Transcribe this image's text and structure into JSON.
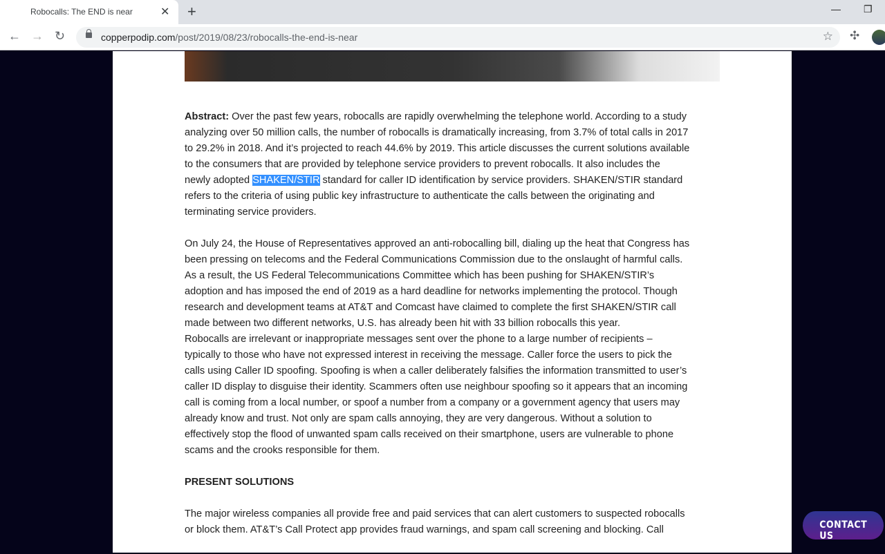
{
  "browser": {
    "tab_title": "Robocalls: The END is near",
    "url_domain": "copperpodip.com",
    "url_path": "/post/2019/08/23/robocalls-the-end-is-near"
  },
  "article": {
    "abstract_label": "Abstract:",
    "abstract_lines": [
      " Over the past few years, robocalls are rapidly overwhelming the telephone world. According to a study",
      "analyzing over 50 million calls, the number of robocalls is dramatically increasing, from 3.7% of total calls in 2017",
      "to 29.2% in 2018. And it’s projected to reach 44.6% by 2019. This article discusses the current solutions available",
      "to the consumers that are provided by telephone service providers to prevent robocalls. It also includes the"
    ],
    "abstract_pre_highlight": "newly adopted ",
    "abstract_highlight": "SHAKEN/STIR",
    "abstract_post_highlight": " standard for caller ID identification by service providers. SHAKEN/STIR standard",
    "abstract_tail": [
      "refers to the criteria of using public key infrastructure to authenticate the calls between the originating and",
      "terminating service providers."
    ],
    "para2_lines": [
      "On July 24, the House of Representatives approved an anti-robocalling bill, dialing up the heat that Congress has",
      "been pressing on telecoms and the Federal Communications Commission due to the onslaught of harmful calls.",
      "As a result, the US Federal Telecommunications Committee which has been pushing for SHAKEN/STIR’s",
      "adoption and has imposed the end of 2019 as a hard deadline for networks implementing the protocol. Though",
      "research and development teams at AT&T and Comcast have claimed to complete the first SHAKEN/STIR call",
      "made between two different networks, U.S. has already been hit with 33 billion robocalls this year.",
      "Robocalls are irrelevant or inappropriate messages sent over the phone to a large number of recipients –",
      "typically to those who have not expressed interest in receiving the message. Caller force the users to pick the",
      "calls using Caller ID spoofing. Spoofing is when a caller deliberately falsifies the information transmitted to user’s",
      "caller ID display to disguise their identity. Scammers often use neighbour spoofing so it appears that an incoming",
      "call is coming from a local number, or spoof a number from a company or a government agency that users may",
      "already know and trust. Not only are spam calls annoying, they are very dangerous. Without a solution to",
      "effectively stop the flood of unwanted spam calls received on their smartphone, users are vulnerable to phone",
      "scams and the crooks responsible for them."
    ],
    "heading": "PRESENT SOLUTIONS",
    "para3_lines": [
      "The major wireless companies all provide free and paid services that can alert customers to suspected robocalls",
      "or block them. AT&T’s Call Protect app provides fraud warnings, and spam call screening and blocking. Call"
    ]
  },
  "contact_label": "CONTACT US"
}
